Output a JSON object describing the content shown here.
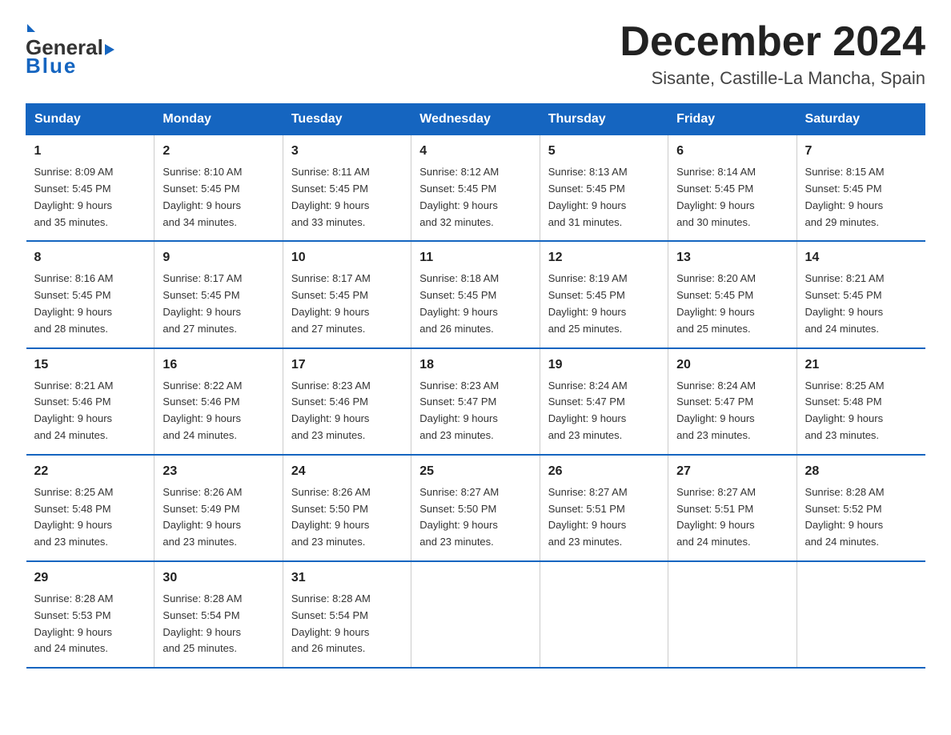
{
  "header": {
    "logo_general": "General",
    "logo_blue": "Blue",
    "month_title": "December 2024",
    "location": "Sisante, Castille-La Mancha, Spain"
  },
  "weekdays": [
    "Sunday",
    "Monday",
    "Tuesday",
    "Wednesday",
    "Thursday",
    "Friday",
    "Saturday"
  ],
  "weeks": [
    [
      {
        "day": "1",
        "sunrise": "8:09 AM",
        "sunset": "5:45 PM",
        "daylight": "9 hours and 35 minutes."
      },
      {
        "day": "2",
        "sunrise": "8:10 AM",
        "sunset": "5:45 PM",
        "daylight": "9 hours and 34 minutes."
      },
      {
        "day": "3",
        "sunrise": "8:11 AM",
        "sunset": "5:45 PM",
        "daylight": "9 hours and 33 minutes."
      },
      {
        "day": "4",
        "sunrise": "8:12 AM",
        "sunset": "5:45 PM",
        "daylight": "9 hours and 32 minutes."
      },
      {
        "day": "5",
        "sunrise": "8:13 AM",
        "sunset": "5:45 PM",
        "daylight": "9 hours and 31 minutes."
      },
      {
        "day": "6",
        "sunrise": "8:14 AM",
        "sunset": "5:45 PM",
        "daylight": "9 hours and 30 minutes."
      },
      {
        "day": "7",
        "sunrise": "8:15 AM",
        "sunset": "5:45 PM",
        "daylight": "9 hours and 29 minutes."
      }
    ],
    [
      {
        "day": "8",
        "sunrise": "8:16 AM",
        "sunset": "5:45 PM",
        "daylight": "9 hours and 28 minutes."
      },
      {
        "day": "9",
        "sunrise": "8:17 AM",
        "sunset": "5:45 PM",
        "daylight": "9 hours and 27 minutes."
      },
      {
        "day": "10",
        "sunrise": "8:17 AM",
        "sunset": "5:45 PM",
        "daylight": "9 hours and 27 minutes."
      },
      {
        "day": "11",
        "sunrise": "8:18 AM",
        "sunset": "5:45 PM",
        "daylight": "9 hours and 26 minutes."
      },
      {
        "day": "12",
        "sunrise": "8:19 AM",
        "sunset": "5:45 PM",
        "daylight": "9 hours and 25 minutes."
      },
      {
        "day": "13",
        "sunrise": "8:20 AM",
        "sunset": "5:45 PM",
        "daylight": "9 hours and 25 minutes."
      },
      {
        "day": "14",
        "sunrise": "8:21 AM",
        "sunset": "5:45 PM",
        "daylight": "9 hours and 24 minutes."
      }
    ],
    [
      {
        "day": "15",
        "sunrise": "8:21 AM",
        "sunset": "5:46 PM",
        "daylight": "9 hours and 24 minutes."
      },
      {
        "day": "16",
        "sunrise": "8:22 AM",
        "sunset": "5:46 PM",
        "daylight": "9 hours and 24 minutes."
      },
      {
        "day": "17",
        "sunrise": "8:23 AM",
        "sunset": "5:46 PM",
        "daylight": "9 hours and 23 minutes."
      },
      {
        "day": "18",
        "sunrise": "8:23 AM",
        "sunset": "5:47 PM",
        "daylight": "9 hours and 23 minutes."
      },
      {
        "day": "19",
        "sunrise": "8:24 AM",
        "sunset": "5:47 PM",
        "daylight": "9 hours and 23 minutes."
      },
      {
        "day": "20",
        "sunrise": "8:24 AM",
        "sunset": "5:47 PM",
        "daylight": "9 hours and 23 minutes."
      },
      {
        "day": "21",
        "sunrise": "8:25 AM",
        "sunset": "5:48 PM",
        "daylight": "9 hours and 23 minutes."
      }
    ],
    [
      {
        "day": "22",
        "sunrise": "8:25 AM",
        "sunset": "5:48 PM",
        "daylight": "9 hours and 23 minutes."
      },
      {
        "day": "23",
        "sunrise": "8:26 AM",
        "sunset": "5:49 PM",
        "daylight": "9 hours and 23 minutes."
      },
      {
        "day": "24",
        "sunrise": "8:26 AM",
        "sunset": "5:50 PM",
        "daylight": "9 hours and 23 minutes."
      },
      {
        "day": "25",
        "sunrise": "8:27 AM",
        "sunset": "5:50 PM",
        "daylight": "9 hours and 23 minutes."
      },
      {
        "day": "26",
        "sunrise": "8:27 AM",
        "sunset": "5:51 PM",
        "daylight": "9 hours and 23 minutes."
      },
      {
        "day": "27",
        "sunrise": "8:27 AM",
        "sunset": "5:51 PM",
        "daylight": "9 hours and 24 minutes."
      },
      {
        "day": "28",
        "sunrise": "8:28 AM",
        "sunset": "5:52 PM",
        "daylight": "9 hours and 24 minutes."
      }
    ],
    [
      {
        "day": "29",
        "sunrise": "8:28 AM",
        "sunset": "5:53 PM",
        "daylight": "9 hours and 24 minutes."
      },
      {
        "day": "30",
        "sunrise": "8:28 AM",
        "sunset": "5:54 PM",
        "daylight": "9 hours and 25 minutes."
      },
      {
        "day": "31",
        "sunrise": "8:28 AM",
        "sunset": "5:54 PM",
        "daylight": "9 hours and 26 minutes."
      },
      null,
      null,
      null,
      null
    ]
  ]
}
